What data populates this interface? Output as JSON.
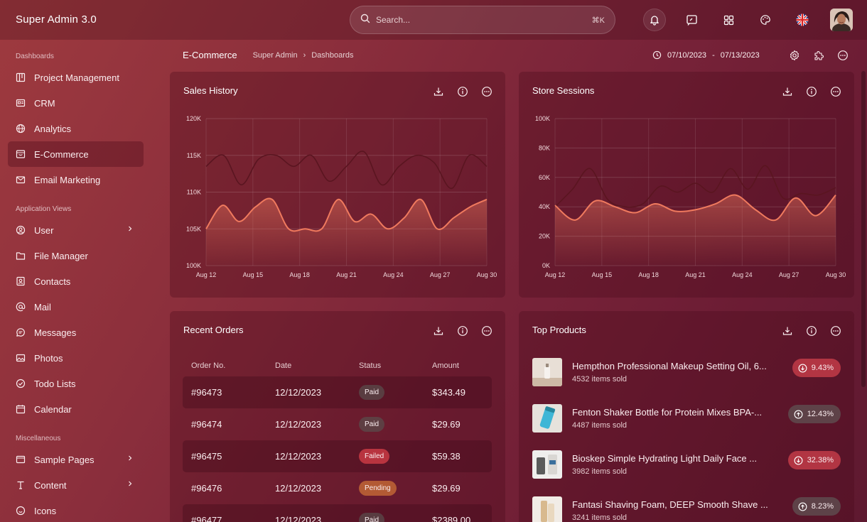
{
  "app": {
    "title": "Super Admin 3.0"
  },
  "search": {
    "placeholder": "Search...",
    "shortcut": "⌘K"
  },
  "topbar_icons": [
    "bell-icon",
    "chat-icon",
    "apps-grid-icon",
    "palette-icon",
    "uk-flag-icon"
  ],
  "sidebar": {
    "sections": [
      {
        "title": "Dashboards",
        "items": [
          {
            "label": "Project Management",
            "icon": "board-icon"
          },
          {
            "label": "CRM",
            "icon": "id-card-icon"
          },
          {
            "label": "Analytics",
            "icon": "globe-icon"
          },
          {
            "label": "E-Commerce",
            "icon": "store-icon",
            "active": true
          },
          {
            "label": "Email Marketing",
            "icon": "mail-icon"
          }
        ]
      },
      {
        "title": "Application Views",
        "items": [
          {
            "label": "User",
            "icon": "user-icon",
            "chevron": true
          },
          {
            "label": "File Manager",
            "icon": "folder-icon"
          },
          {
            "label": "Contacts",
            "icon": "contact-icon"
          },
          {
            "label": "Mail",
            "icon": "at-icon"
          },
          {
            "label": "Messages",
            "icon": "message-icon"
          },
          {
            "label": "Photos",
            "icon": "image-icon"
          },
          {
            "label": "Todo Lists",
            "icon": "check-circle-icon"
          },
          {
            "label": "Calendar",
            "icon": "calendar-icon"
          }
        ]
      },
      {
        "title": "Miscellaneous",
        "items": [
          {
            "label": "Sample Pages",
            "icon": "page-icon",
            "chevron": true
          },
          {
            "label": "Content",
            "icon": "text-icon",
            "chevron": true
          },
          {
            "label": "Icons",
            "icon": "smile-icon"
          }
        ]
      }
    ]
  },
  "page": {
    "title": "E-Commerce",
    "breadcrumb": [
      "Super Admin",
      "Dashboards"
    ],
    "date_from": "07/10/2023",
    "date_sep": "-",
    "date_to": "07/13/2023"
  },
  "cards": {
    "sales_history": {
      "title": "Sales History"
    },
    "store_sessions": {
      "title": "Store Sessions"
    },
    "recent_orders": {
      "title": "Recent Orders"
    },
    "top_products": {
      "title": "Top Products"
    }
  },
  "chart_data": [
    {
      "type": "area",
      "title": "Sales History",
      "x": [
        "Aug 12",
        "Aug 15",
        "Aug 18",
        "Aug 21",
        "Aug 24",
        "Aug 27",
        "Aug 30"
      ],
      "y_ticks": [
        "100K",
        "105K",
        "110K",
        "115K",
        "120K"
      ],
      "ylim": [
        100000,
        120000
      ],
      "grid": true,
      "series": [
        {
          "values": [
            105000,
            108200,
            106000,
            108000,
            109000,
            105000,
            105000,
            105000,
            109000,
            106000,
            107000,
            105000,
            106500,
            109000,
            105000,
            106500,
            108000,
            109000
          ],
          "color": "#f07a5e"
        },
        {
          "values": [
            113500,
            115000,
            111000,
            114500,
            115000,
            113500,
            115000,
            111500,
            113500,
            115500,
            111000,
            113500,
            115000,
            114000,
            110500,
            115000,
            113500
          ],
          "color": "#5a1520"
        }
      ]
    },
    {
      "type": "area",
      "title": "Store Sessions",
      "x": [
        "Aug 12",
        "Aug 15",
        "Aug 18",
        "Aug 21",
        "Aug 24",
        "Aug 27",
        "Aug 30"
      ],
      "y_ticks": [
        "0K",
        "20K",
        "40K",
        "60K",
        "80K",
        "100K"
      ],
      "ylim": [
        0,
        100000
      ],
      "grid": true,
      "series": [
        {
          "values": [
            41000,
            31000,
            44000,
            40000,
            36000,
            42000,
            37000,
            38000,
            42000,
            48000,
            38000,
            31000,
            46000,
            34000,
            48000
          ],
          "color": "#f07a5e"
        },
        {
          "values": [
            40000,
            52000,
            66000,
            45000,
            40000,
            42000,
            54000,
            50000,
            56000,
            50000,
            66000,
            52000,
            68000,
            46000,
            49000,
            48000,
            53000
          ],
          "color": "#5a1520"
        }
      ]
    }
  ],
  "orders": {
    "columns": [
      "Order No.",
      "Date",
      "Status",
      "Amount"
    ],
    "rows": [
      {
        "no": "#96473",
        "date": "12/12/2023",
        "status": "Paid",
        "amount": "$343.49"
      },
      {
        "no": "#96474",
        "date": "12/12/2023",
        "status": "Paid",
        "amount": "$29.69"
      },
      {
        "no": "#96475",
        "date": "12/12/2023",
        "status": "Failed",
        "amount": "$59.38"
      },
      {
        "no": "#96476",
        "date": "12/12/2023",
        "status": "Pending",
        "amount": "$29.69"
      },
      {
        "no": "#96477",
        "date": "12/12/2023",
        "status": "Paid",
        "amount": "$2389.00"
      }
    ]
  },
  "products": [
    {
      "name": "Hempthon Professional Makeup Setting Oil, 6...",
      "sold": "4532 items sold",
      "change": "9.43%",
      "trend": "down"
    },
    {
      "name": "Fenton Shaker Bottle for Protein Mixes BPA-...",
      "sold": "4487 items sold",
      "change": "12.43%",
      "trend": "up"
    },
    {
      "name": "Bioskep Simple Hydrating Light Daily Face ...",
      "sold": "3982 items sold",
      "change": "32.38%",
      "trend": "down"
    },
    {
      "name": "Fantasi Shaving Foam, DEEP Smooth Shave ...",
      "sold": "3241 items sold",
      "change": "8.23%",
      "trend": "up"
    }
  ]
}
